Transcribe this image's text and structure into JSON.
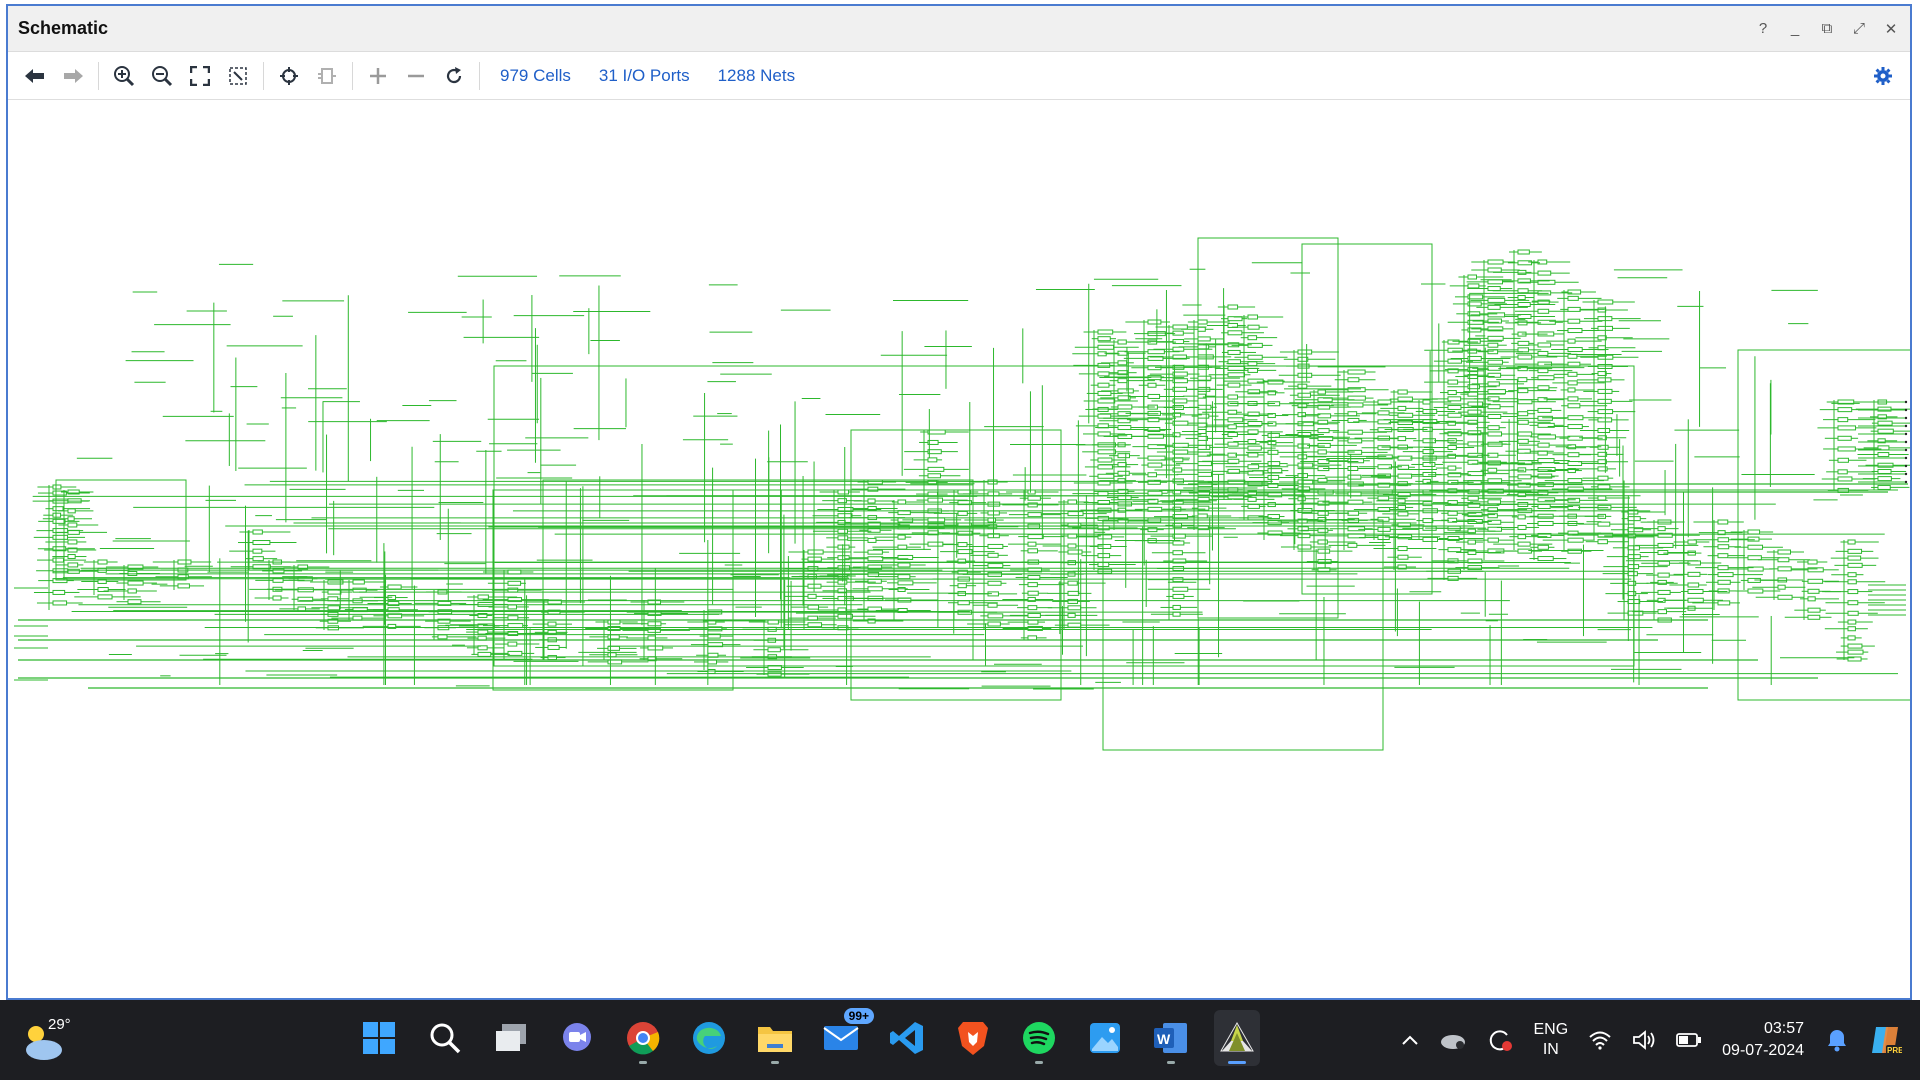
{
  "window": {
    "title": "Schematic",
    "controls": {
      "help": "?",
      "minimize": "_",
      "restore": "⧉",
      "maximize": "⤢",
      "close": "✕"
    }
  },
  "toolbar": {
    "cells": "979 Cells",
    "io_ports": "31 I/O Ports",
    "nets": "1288 Nets"
  },
  "theme": {
    "wire_color": "#2db82d",
    "accent": "#1f5fc8",
    "taskbar_bg": "#1d1e22"
  },
  "taskbar": {
    "temperature": "29°",
    "mail_badge": "99+",
    "language_line1": "ENG",
    "language_line2": "IN",
    "time": "03:57",
    "date": "09-07-2024"
  }
}
